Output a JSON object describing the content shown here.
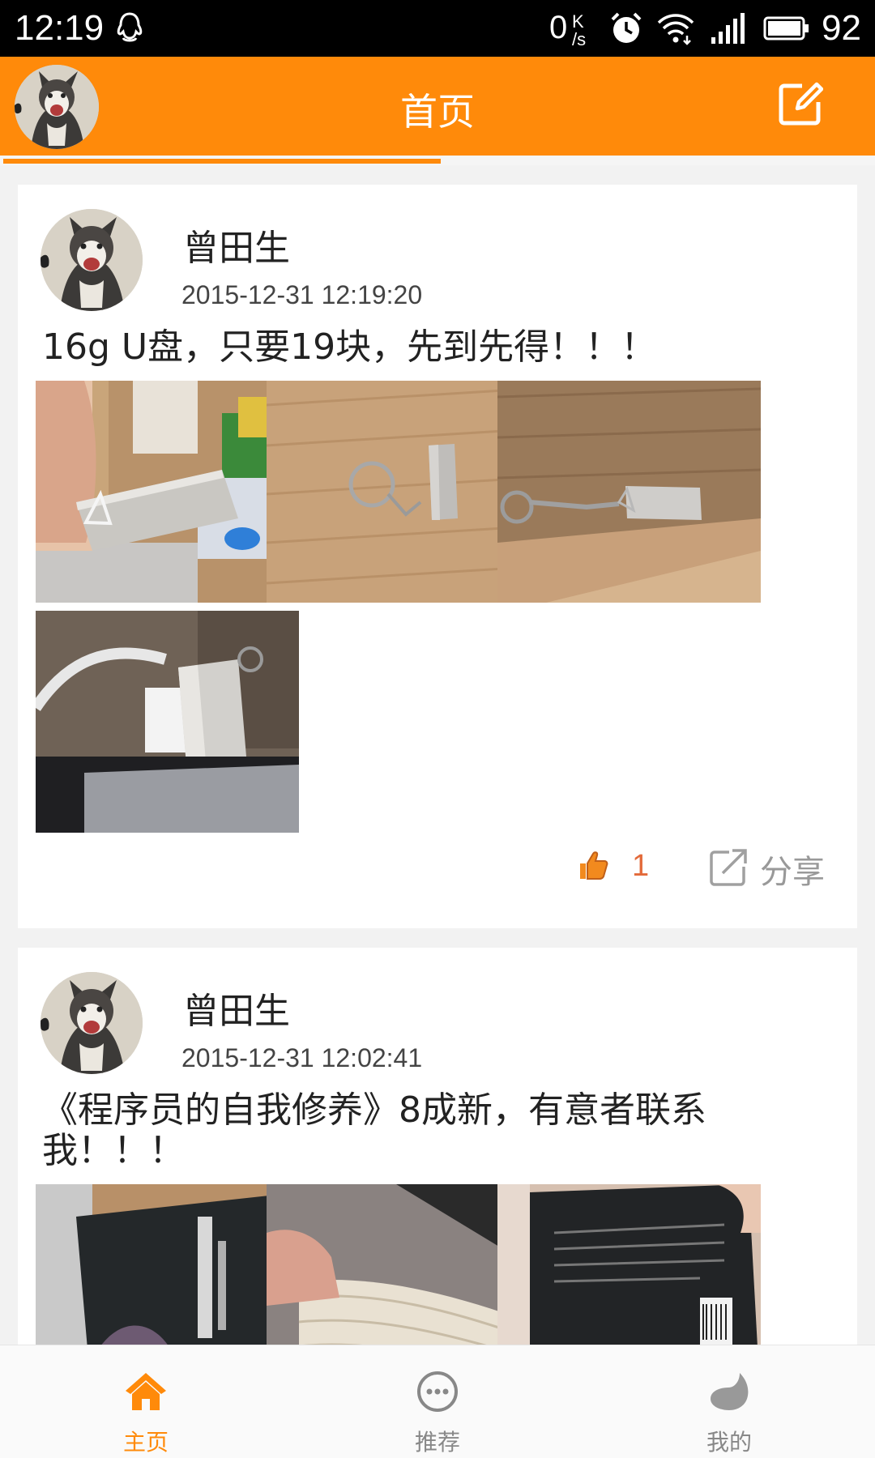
{
  "status_bar": {
    "time": "12:19",
    "speed_value": "0",
    "speed_unit_top": "K",
    "speed_unit_bottom": "/s",
    "battery": "92",
    "icons": [
      "qq-icon",
      "alarm-icon",
      "wifi-icon",
      "signal-icon",
      "battery-icon"
    ]
  },
  "header": {
    "title": "首页",
    "accent_color": "#ff8a0a",
    "icons": [
      "avatar",
      "edit-icon"
    ]
  },
  "posts": [
    {
      "author": "曾田生",
      "time": "2015-12-31 12:19:20",
      "text": "16g U盘，只要19块，先到先得！！！",
      "likes": "1",
      "share_label": "分享",
      "image_count": 4
    },
    {
      "author": "曾田生",
      "time": "2015-12-31 12:02:41",
      "text": "《程序员的自我修养》8成新，有意者联系我！！！",
      "image_count": 3
    }
  ],
  "bottom_nav": {
    "items": [
      {
        "label": "主页",
        "icon": "home-icon",
        "active": true
      },
      {
        "label": "推荐",
        "icon": "chat-bubble-icon",
        "active": false
      },
      {
        "label": "我的",
        "icon": "profile-blob-icon",
        "active": false
      }
    ]
  }
}
